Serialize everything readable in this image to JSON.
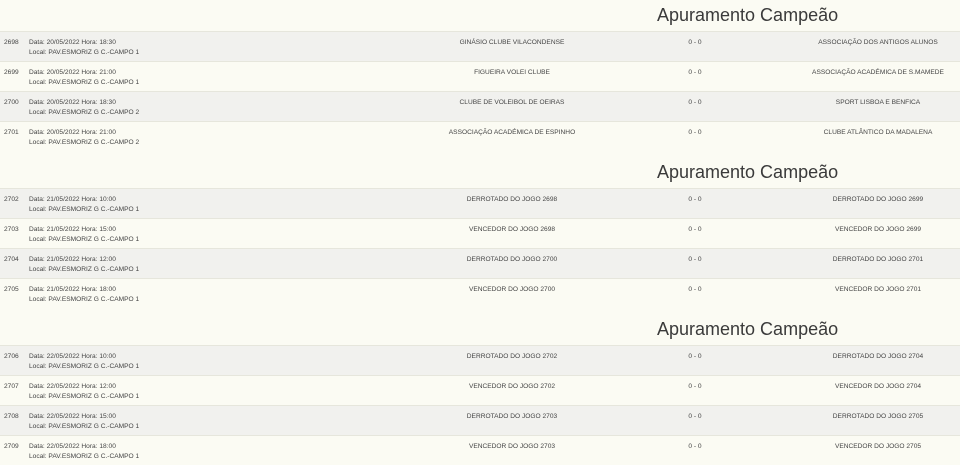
{
  "sections": [
    {
      "title": "Apuramento Campeão",
      "matches": [
        {
          "num": "2698",
          "date": "Data: 20/05/2022 Hora: 18:30",
          "local": "Local: PAV.ESMORIZ G C.-CAMPO 1",
          "home": "GINÁSIO CLUBE VILACONDENSE",
          "score": "0 - 0",
          "away": "ASSOCIAÇÃO DOS ANTIGOS ALUNOS"
        },
        {
          "num": "2699",
          "date": "Data: 20/05/2022 Hora: 21:00",
          "local": "Local: PAV.ESMORIZ G C.-CAMPO 1",
          "home": "FIGUEIRA VOLEI CLUBE",
          "score": "0 - 0",
          "away": "ASSOCIAÇÃO ACADÉMICA DE S.MAMEDE"
        },
        {
          "num": "2700",
          "date": "Data: 20/05/2022 Hora: 18:30",
          "local": "Local: PAV.ESMORIZ G C.-CAMPO 2",
          "home": "CLUBE DE VOLEIBOL DE OEIRAS",
          "score": "0 - 0",
          "away": "SPORT LISBOA E BENFICA"
        },
        {
          "num": "2701",
          "date": "Data: 20/05/2022 Hora: 21:00",
          "local": "Local: PAV.ESMORIZ G C.-CAMPO 2",
          "home": "ASSOCIAÇÃO ACADÉMICA DE ESPINHO",
          "score": "0 - 0",
          "away": "CLUBE ATLÂNTICO DA MADALENA"
        }
      ]
    },
    {
      "title": "Apuramento Campeão",
      "matches": [
        {
          "num": "2702",
          "date": "Data: 21/05/2022 Hora: 10:00",
          "local": "Local: PAV.ESMORIZ G C.-CAMPO 1",
          "home": "DERROTADO DO JOGO 2698",
          "score": "0 - 0",
          "away": "DERROTADO DO JOGO 2699"
        },
        {
          "num": "2703",
          "date": "Data: 21/05/2022 Hora: 15:00",
          "local": "Local: PAV.ESMORIZ G C.-CAMPO 1",
          "home": "VENCEDOR DO JOGO 2698",
          "score": "0 - 0",
          "away": "VENCEDOR DO JOGO 2699"
        },
        {
          "num": "2704",
          "date": "Data: 21/05/2022 Hora: 12:00",
          "local": "Local: PAV.ESMORIZ G C.-CAMPO 1",
          "home": "DERROTADO DO JOGO 2700",
          "score": "0 - 0",
          "away": "DERROTADO DO JOGO 2701"
        },
        {
          "num": "2705",
          "date": "Data: 21/05/2022 Hora: 18:00",
          "local": "Local: PAV.ESMORIZ G C.-CAMPO 1",
          "home": "VENCEDOR DO JOGO 2700",
          "score": "0 - 0",
          "away": "VENCEDOR DO JOGO 2701"
        }
      ]
    },
    {
      "title": "Apuramento Campeão",
      "matches": [
        {
          "num": "2706",
          "date": "Data: 22/05/2022 Hora: 10:00",
          "local": "Local: PAV.ESMORIZ G C.-CAMPO 1",
          "home": "DERROTADO DO JOGO 2702",
          "score": "0 - 0",
          "away": "DERROTADO DO JOGO 2704"
        },
        {
          "num": "2707",
          "date": "Data: 22/05/2022 Hora: 12:00",
          "local": "Local: PAV.ESMORIZ G C.-CAMPO 1",
          "home": "VENCEDOR DO JOGO 2702",
          "score": "0 - 0",
          "away": "VENCEDOR DO JOGO 2704"
        },
        {
          "num": "2708",
          "date": "Data: 22/05/2022 Hora: 15:00",
          "local": "Local: PAV.ESMORIZ G C.-CAMPO 1",
          "home": "DERROTADO DO JOGO 2703",
          "score": "0 - 0",
          "away": "DERROTADO DO JOGO 2705"
        },
        {
          "num": "2709",
          "date": "Data: 22/05/2022 Hora: 18:00",
          "local": "Local: PAV.ESMORIZ G C.-CAMPO 1",
          "home": "VENCEDOR DO JOGO 2703",
          "score": "0 - 0",
          "away": "VENCEDOR DO JOGO 2705"
        }
      ]
    }
  ]
}
